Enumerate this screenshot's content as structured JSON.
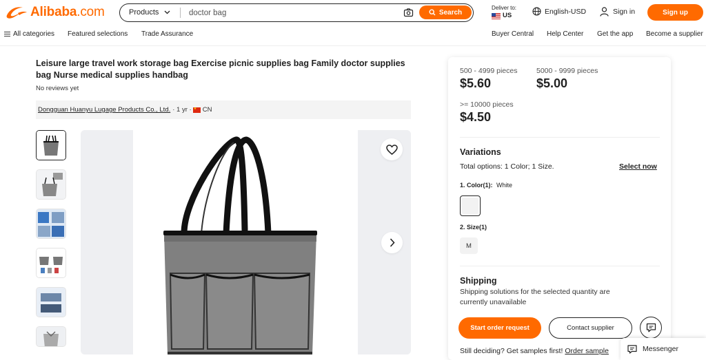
{
  "header": {
    "logo_text": "Alibaba",
    "logo_suffix": ".com",
    "search": {
      "category": "Products",
      "query": "doctor bag",
      "button_label": "Search"
    },
    "deliver": {
      "label": "Deliver to:",
      "country": "US"
    },
    "language": "English-USD",
    "signin_label": "Sign in",
    "signup_label": "Sign up",
    "brand_color": "#ff6a00"
  },
  "subnav": {
    "left": [
      "All categories",
      "Featured selections",
      "Trade Assurance"
    ],
    "right": [
      "Buyer Central",
      "Help Center",
      "Get the app",
      "Become a supplier"
    ]
  },
  "product": {
    "title": "Leisure large travel work storage bag Exercise picnic supplies bag Family doctor supplies bag Nurse medical supplies handbag",
    "reviews": "No reviews yet",
    "supplier": {
      "name": "Dongguan Huanyu Lugage Products Co., Ltd.",
      "years": "· 1 yr ·",
      "country": "CN"
    },
    "thumbnail_count": 6
  },
  "pricing": {
    "tiers": [
      {
        "qty": "500 - 4999 pieces",
        "price": "$5.60"
      },
      {
        "qty": "5000 - 9999 pieces",
        "price": "$5.00"
      },
      {
        "qty": ">= 10000 pieces",
        "price": "$4.50"
      }
    ]
  },
  "variations": {
    "heading": "Variations",
    "total": "Total options: 1 Color; 1 Size.",
    "select_now": "Select now",
    "color_label": "1. Color(1):",
    "color_value": "White",
    "size_label": "2. Size(1)",
    "size_value": "M"
  },
  "shipping": {
    "heading": "Shipping",
    "text": "Shipping solutions for the selected quantity are currently unavailable"
  },
  "actions": {
    "order": "Start order request",
    "contact": "Contact supplier",
    "samples_prefix": "Still deciding? Get samples first!",
    "samples_link": "Order sample"
  },
  "messenger_label": "Messenger"
}
